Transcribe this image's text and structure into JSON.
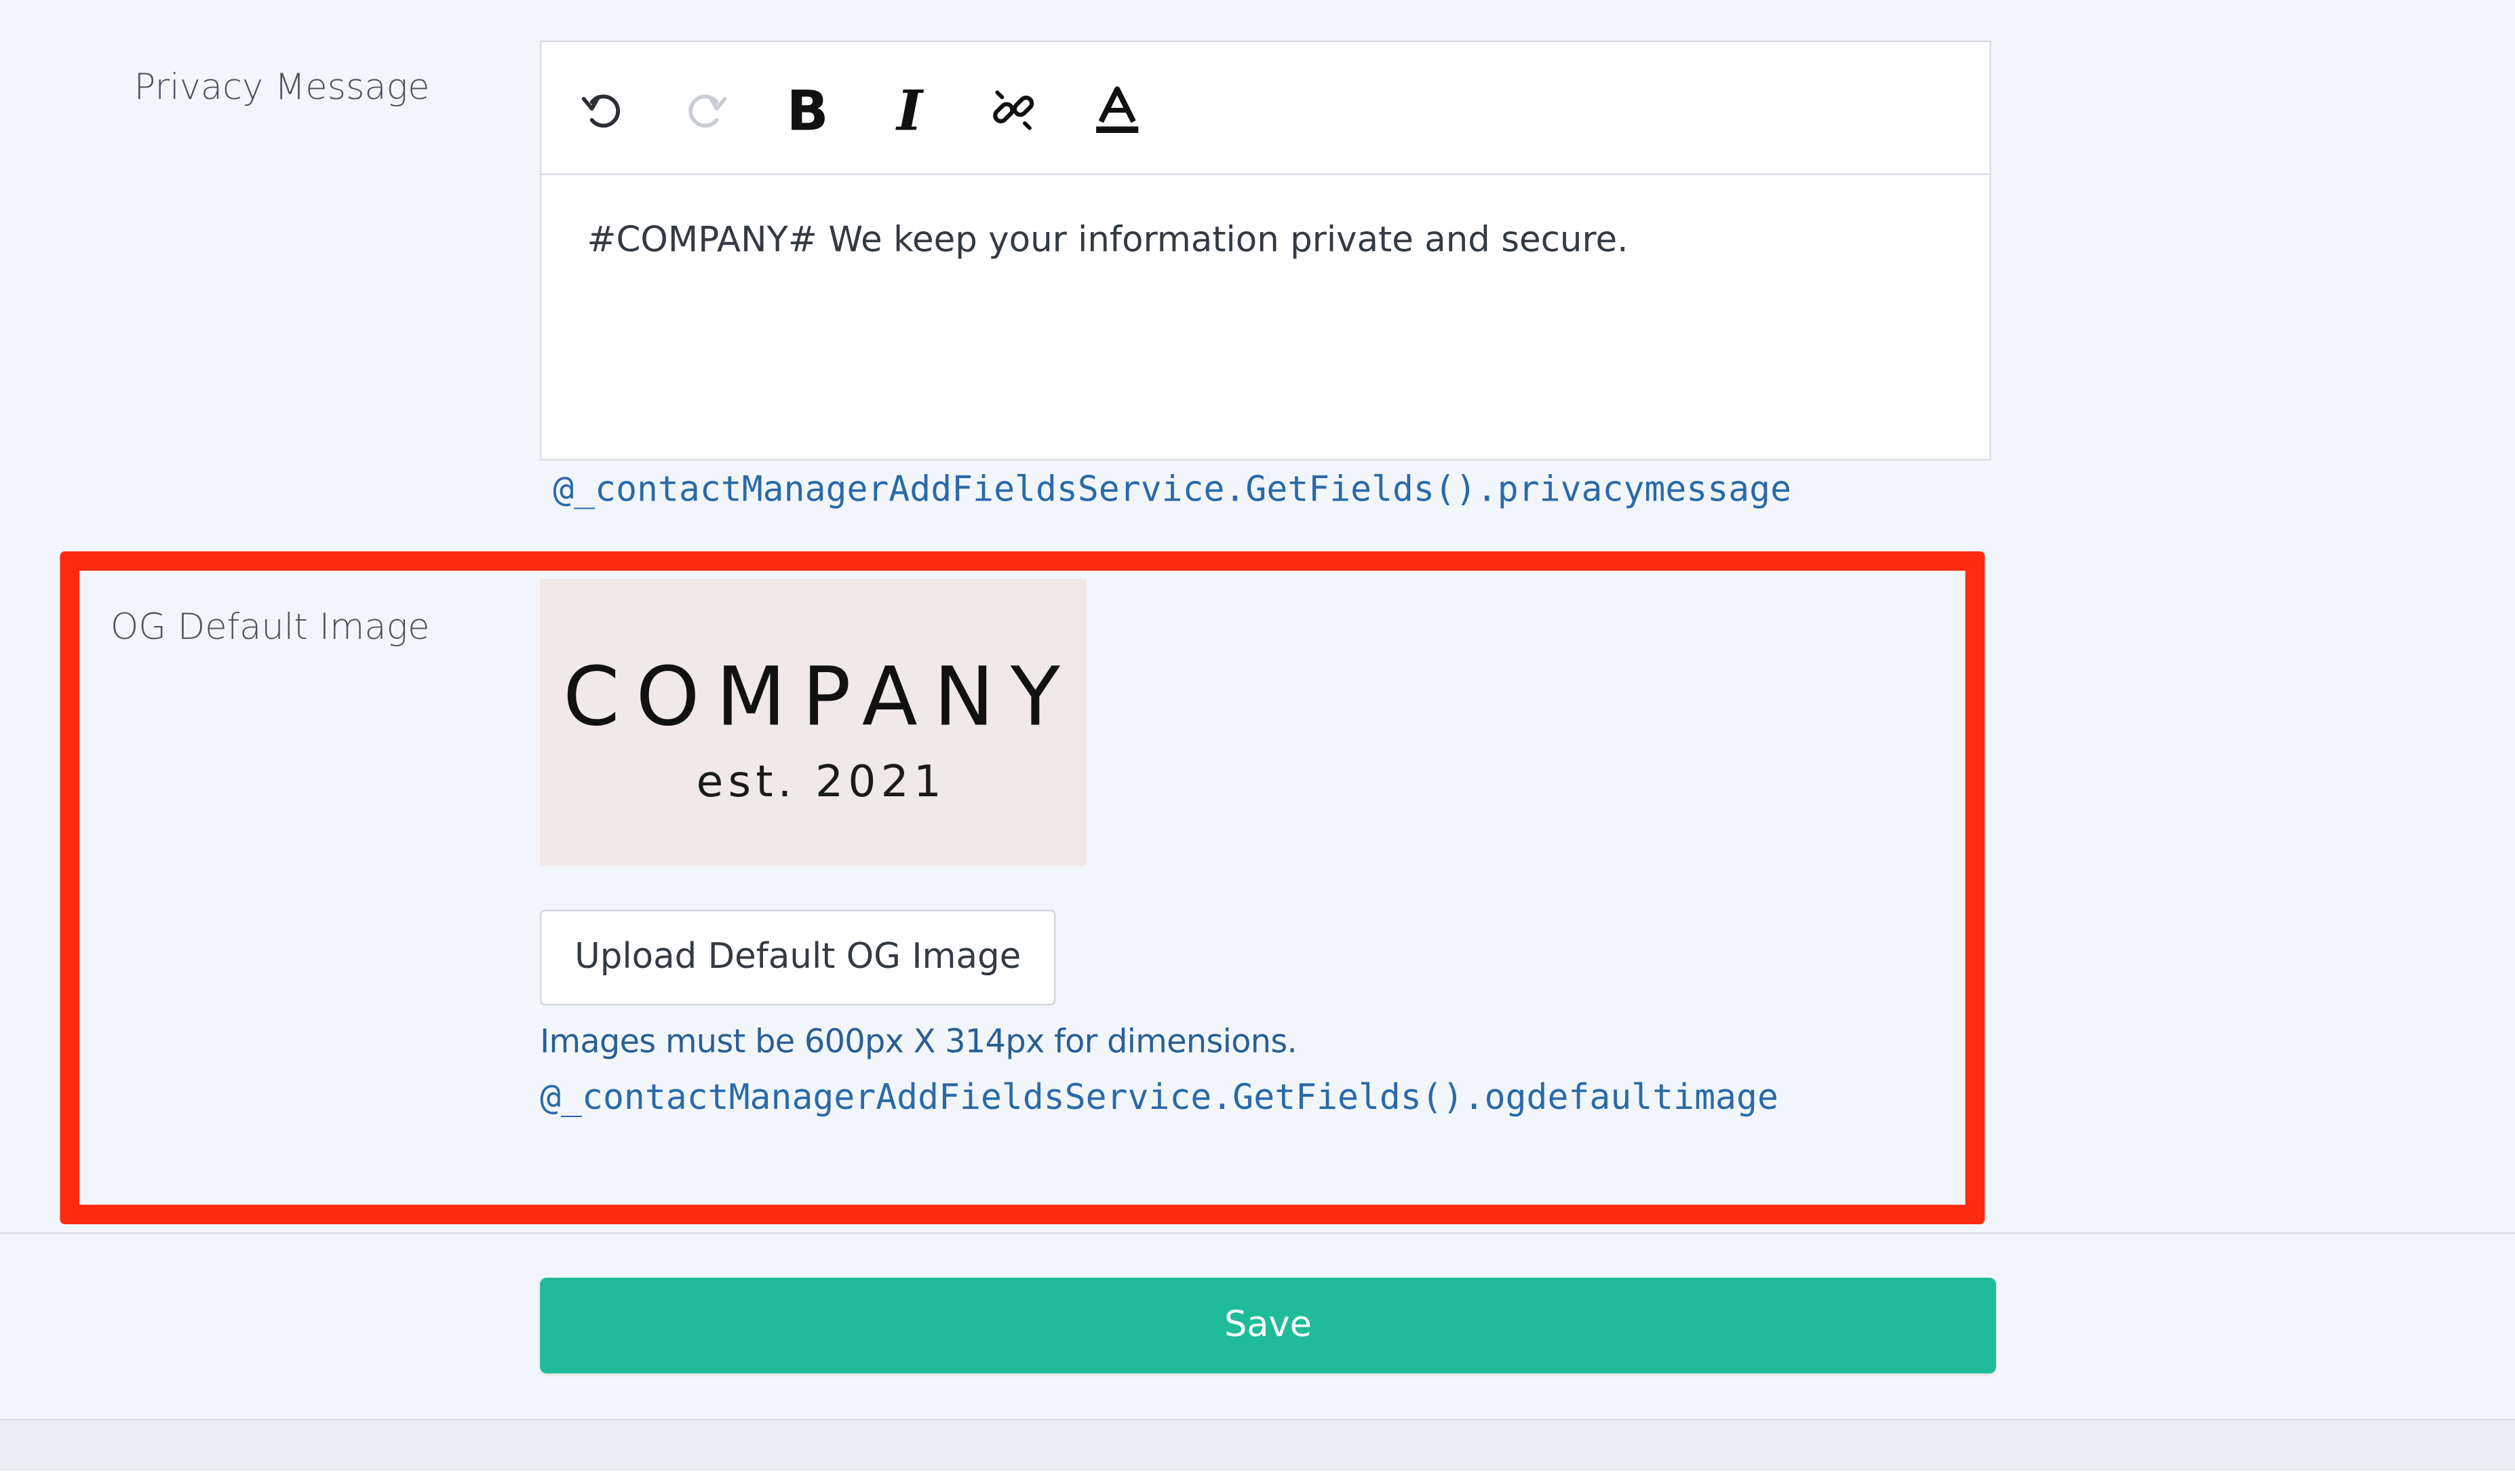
{
  "form": {
    "privacy_label": "Privacy Message",
    "privacy_content": "#COMPANY# We keep your information private and secure.",
    "privacy_ref": "@_contactManagerAddFieldsService.GetFields().privacymessage",
    "og_label": "OG Default Image",
    "og_logo_main": "COMPANY",
    "og_logo_sub": "est. 2021",
    "upload_label": "Upload Default OG Image",
    "hint": "Images must be 600px X 314px for dimensions.",
    "og_ref": "@_contactManagerAddFieldsService.GetFields().ogdefaultimage",
    "save_label": "Save"
  },
  "toolbar": {
    "buttons": [
      "undo-icon",
      "redo-icon",
      "bold-icon",
      "italic-icon",
      "unlink-icon",
      "text-color-icon"
    ]
  },
  "colors": {
    "background": "#f2f6fa",
    "highlight": "#ff2a10",
    "save": "#1fbb9b",
    "link": "#2a6aa8"
  }
}
